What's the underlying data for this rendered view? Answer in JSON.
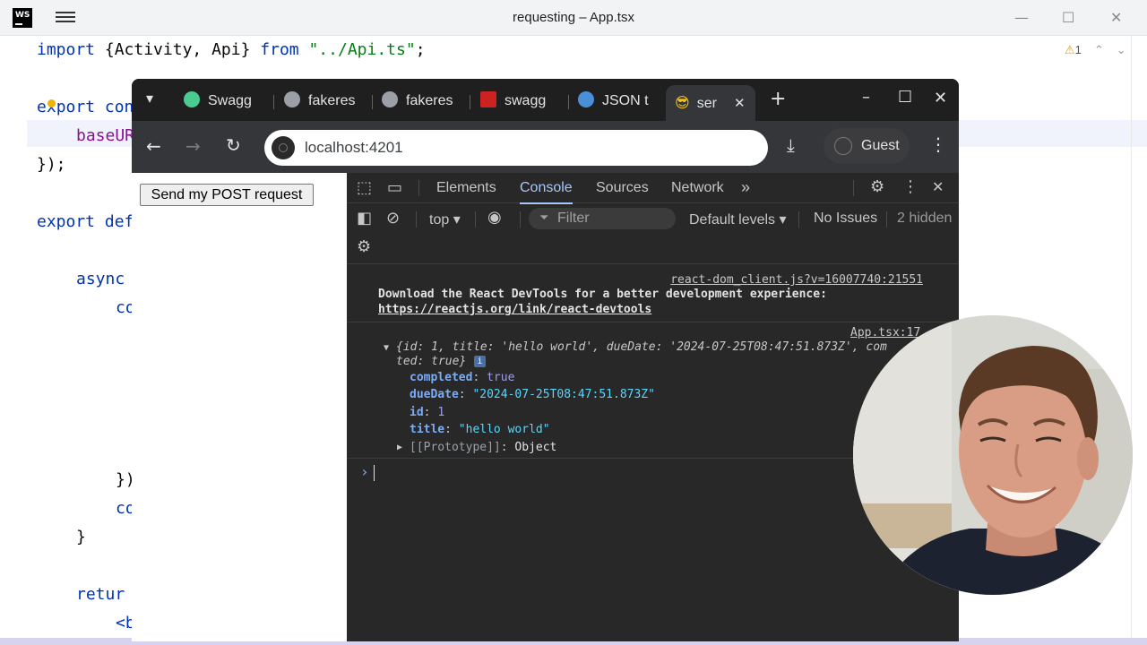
{
  "ide": {
    "logo": "WS",
    "title": "requesting – App.tsx",
    "warnings": "1",
    "code": {
      "l1": {
        "kw1": "import",
        "mid": " {Activity, Api} ",
        "kw2": "from",
        "sp": " ",
        "str": "\"../Api.ts\"",
        "end": ";"
      },
      "l2": {
        "kw": "ex",
        "rest": "port con"
      },
      "l3": "baseUR",
      "l4": "});",
      "l5": {
        "kw": "export de",
        "rest": "f"
      },
      "l6": "async",
      "l7": "co",
      "l8": "})",
      "l9": "co",
      "l10": "}",
      "l11": "retur",
      "l12": "<b"
    }
  },
  "browser": {
    "tabs": [
      {
        "label": "Swagg",
        "color": "#49cc90"
      },
      {
        "label": "fakeres",
        "color": "#9aa0a6"
      },
      {
        "label": "fakeres",
        "color": "#9aa0a6"
      },
      {
        "label": "swagg",
        "color": "#cc2222"
      },
      {
        "label": "JSON t",
        "color": "#4a90d9"
      },
      {
        "label": "ser",
        "color": "#f5c518",
        "glyph": "😎"
      }
    ],
    "url": "localhost:4201",
    "guest_label": "Guest",
    "icons": {
      "tab_search": "▾",
      "new_tab": "+",
      "minimize": "–",
      "maximize": "☐",
      "close": "✕",
      "back": "←",
      "forward": "→",
      "reload": "↻",
      "download": "⤓",
      "menu": "⋮"
    }
  },
  "page": {
    "button_label": "Send my POST request"
  },
  "devtools": {
    "tabs": [
      "Elements",
      "Console",
      "Sources",
      "Network"
    ],
    "active_tab": "Console",
    "more": "»",
    "context": "top ▾",
    "filter_placeholder": "Filter",
    "levels": "Default levels ▾",
    "issues": "No Issues",
    "hidden": "2 hidden",
    "console": {
      "msg1_src": "react-dom_client.js?v=16007740:21551",
      "msg1_text": "Download the React DevTools for a better development experience:",
      "msg1_link": "https://reactjs.org/link/react-devtools",
      "msg2_src": "App.tsx:17",
      "preview_1": "{id: 1, title: 'hello world', dueDate: '2024-07-25T08:47:51.873Z', com",
      "preview_2": "ted: true}",
      "info_badge": "i",
      "props": [
        {
          "key": "completed",
          "value": "true",
          "type": "b"
        },
        {
          "key": "dueDate",
          "value": "\"2024-07-25T08:47:51.873Z\"",
          "type": "s"
        },
        {
          "key": "id",
          "value": "1",
          "type": "n"
        },
        {
          "key": "title",
          "value": "\"hello world\"",
          "type": "s"
        }
      ],
      "proto_key": "[[Prototype]]",
      "proto_val": "Object",
      "prompt": "›"
    }
  }
}
